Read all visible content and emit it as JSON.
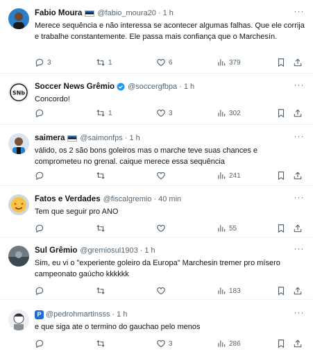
{
  "tweets": [
    {
      "name": "Fabio Moura",
      "handle": "@fabio_moura20",
      "time": "1 h",
      "text": "Merece sequência e não interessa se acontecer algumas falhas.  Que ele corrija e trabalhe constantemente. Ele passa mais confiança que o Marchesín.",
      "replies": "3",
      "retweets": "1",
      "likes": "6",
      "views": "379",
      "avatar_icon": "person-avatar-icon"
    },
    {
      "name": "Soccer News Grêmio",
      "handle": "@soccergfbpa",
      "time": "1 h",
      "text": "Concordo!",
      "replies": "",
      "retweets": "1",
      "likes": "3",
      "views": "302",
      "avatar_icon": "snb-logo-avatar"
    },
    {
      "name": "saimera",
      "handle": "@saimonfps",
      "time": "1 h",
      "text": "válido, os 2 são bons goleiros mas o marche teve suas chances e comprometeu no grenal. caique merece essa sequência",
      "replies": "",
      "retweets": "",
      "likes": "",
      "views": "241",
      "avatar_icon": "player-avatar-icon"
    },
    {
      "name": "Fatos e Verdades",
      "handle": "@fiscalgremio",
      "time": "40 min",
      "text": "Tem que seguir pro ANO",
      "replies": "",
      "retweets": "",
      "likes": "",
      "views": "55",
      "avatar_icon": "emoji-avatar-icon"
    },
    {
      "name": "Sul Grêmio",
      "handle": "@gremiosul1903",
      "time": "1 h",
      "text": "Sim, eu vi o \"experiente goleiro da Europa\" Marchesin tremer pro mísero campeonato gaúcho kkkkkk",
      "replies": "",
      "retweets": "",
      "likes": "",
      "views": "183",
      "avatar_icon": "stadium-avatar-icon"
    },
    {
      "name": "",
      "handle": "@pedrohmartinsss",
      "time": "1 h",
      "text": "e que siga ate o termino do gauchao pelo menos",
      "replies": "",
      "retweets": "",
      "likes": "3",
      "views": "286",
      "avatar_icon": "anime-avatar-icon"
    }
  ],
  "colors": {
    "muted": "#536471",
    "verified": "#1d9bf0",
    "divider": "#eff3f4"
  }
}
